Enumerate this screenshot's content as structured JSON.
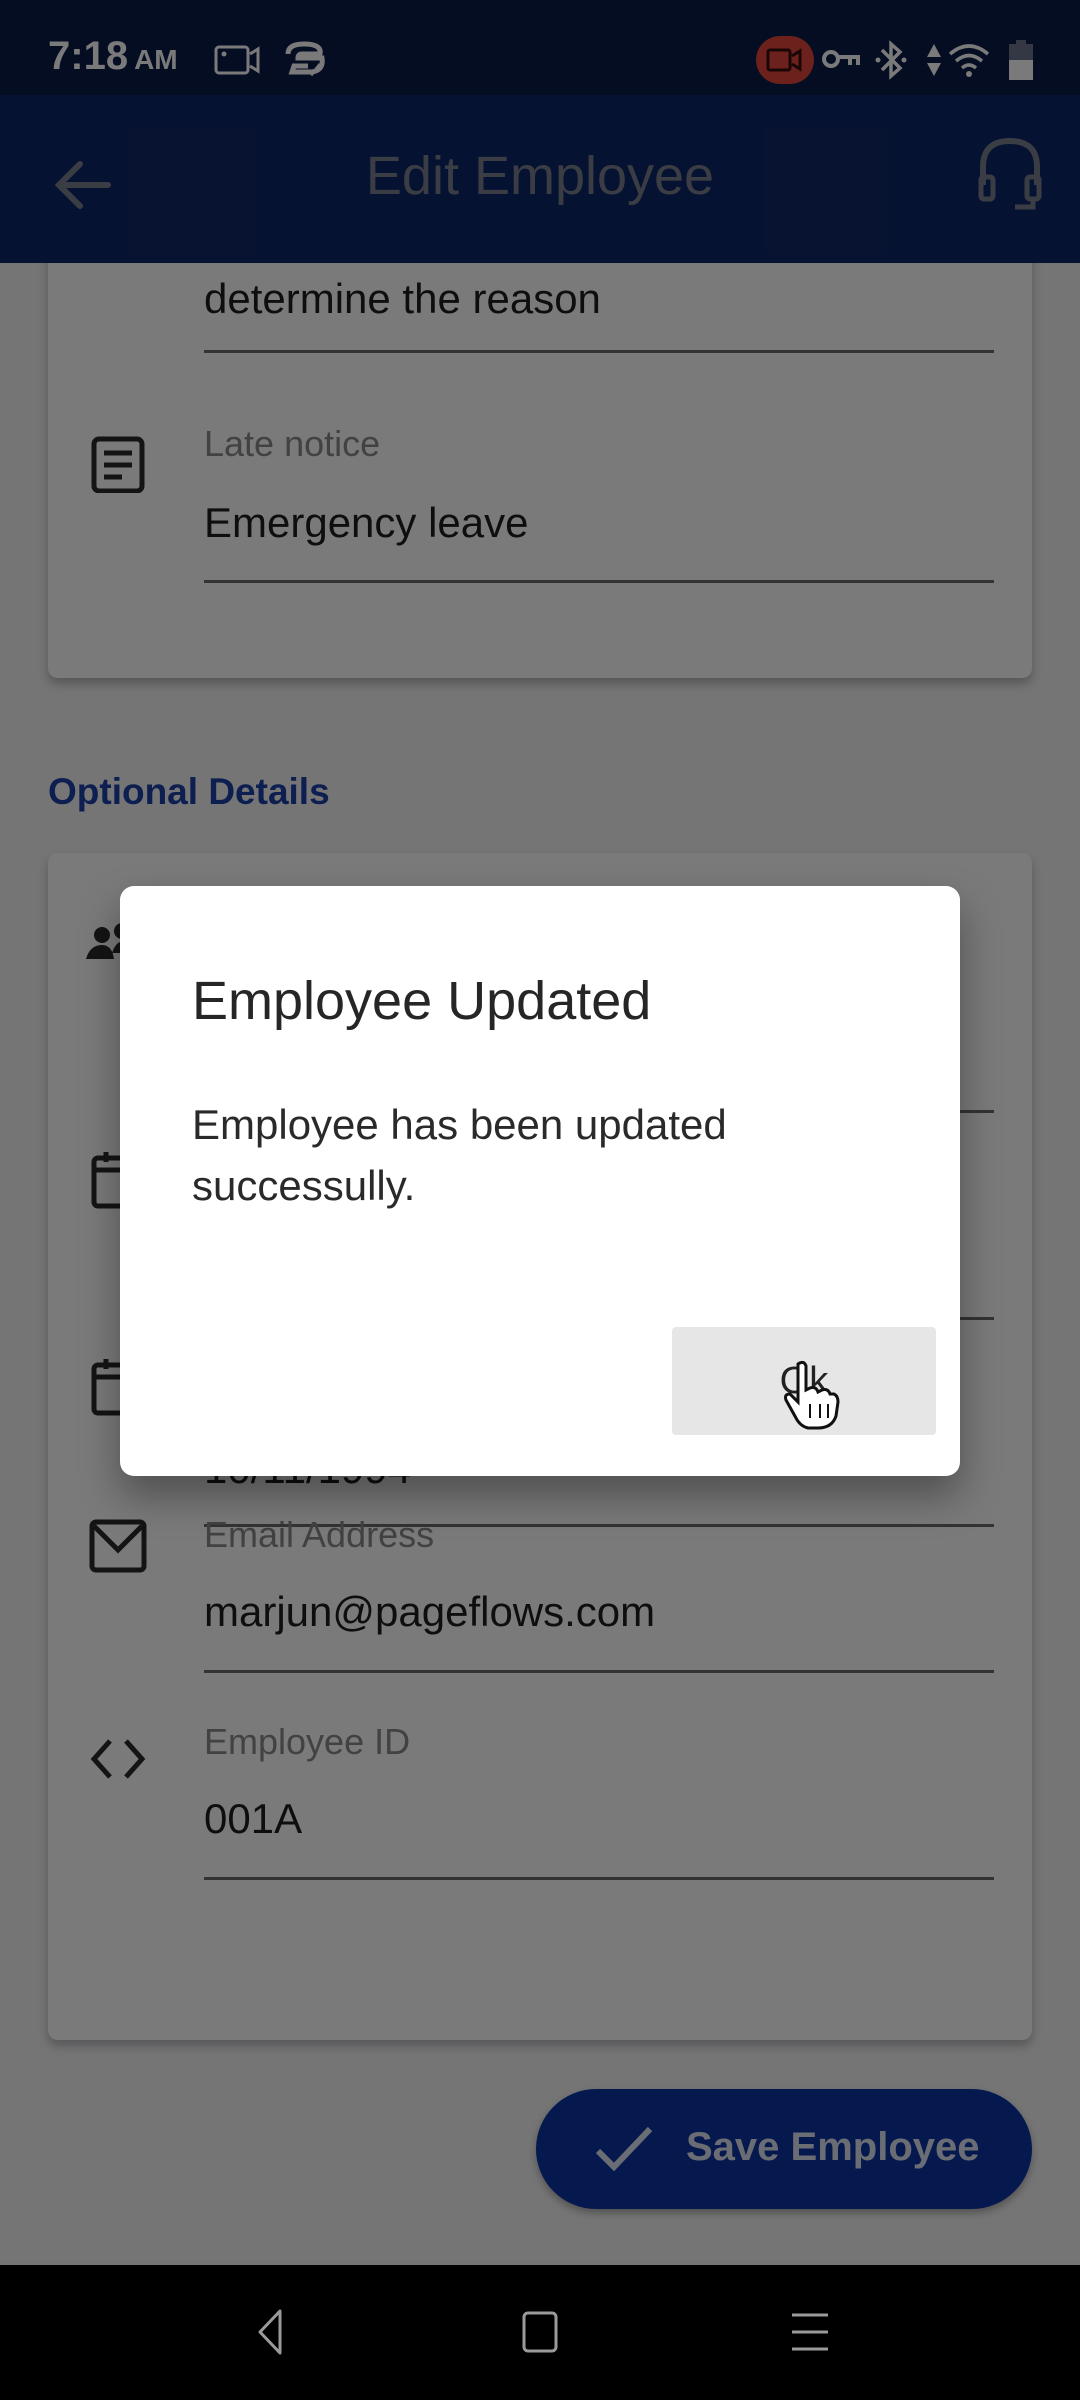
{
  "status_bar": {
    "time": "7:18",
    "ampm": "AM",
    "left_icons": [
      "screen-record-icon",
      "sync-cloud-icon"
    ],
    "right_icons": [
      "recording-indicator-icon",
      "vpn-key-icon",
      "bluetooth-icon",
      "data-arrows-icon",
      "wifi-icon",
      "battery-icon"
    ],
    "recording_color": "#e2453c"
  },
  "app_bar": {
    "title": "Edit Employee",
    "back_icon": "arrow-left-icon",
    "action_icon": "headset-icon",
    "color": "#0e2766"
  },
  "form": {
    "top_card": {
      "partial_value": "determine the reason",
      "fields": [
        {
          "label": "Late notice",
          "value": "Emergency leave",
          "icon": "notes-icon"
        }
      ]
    },
    "optional_section": {
      "title": "Optional Details",
      "fields": [
        {
          "label": "",
          "value": "",
          "icon": "people-icon"
        },
        {
          "label": "",
          "value": "",
          "icon": "calendar-icon"
        },
        {
          "label": "",
          "value": "10/11/1994",
          "icon": "calendar-icon"
        },
        {
          "label": "Email Address",
          "value": "marjun@pageflows.com",
          "icon": "mail-icon"
        },
        {
          "label": "Employee ID",
          "value": "001A",
          "icon": "code-icon"
        }
      ]
    },
    "save_button": {
      "label": "Save Employee",
      "icon": "check-icon",
      "color": "#0e36a6"
    }
  },
  "dialog": {
    "title": "Employee Updated",
    "message": "Employee has been updated successully.",
    "ok_label": "Ok"
  },
  "nav_bar": {
    "buttons": [
      "back-triangle-icon",
      "home-square-icon",
      "recents-menu-icon"
    ]
  }
}
